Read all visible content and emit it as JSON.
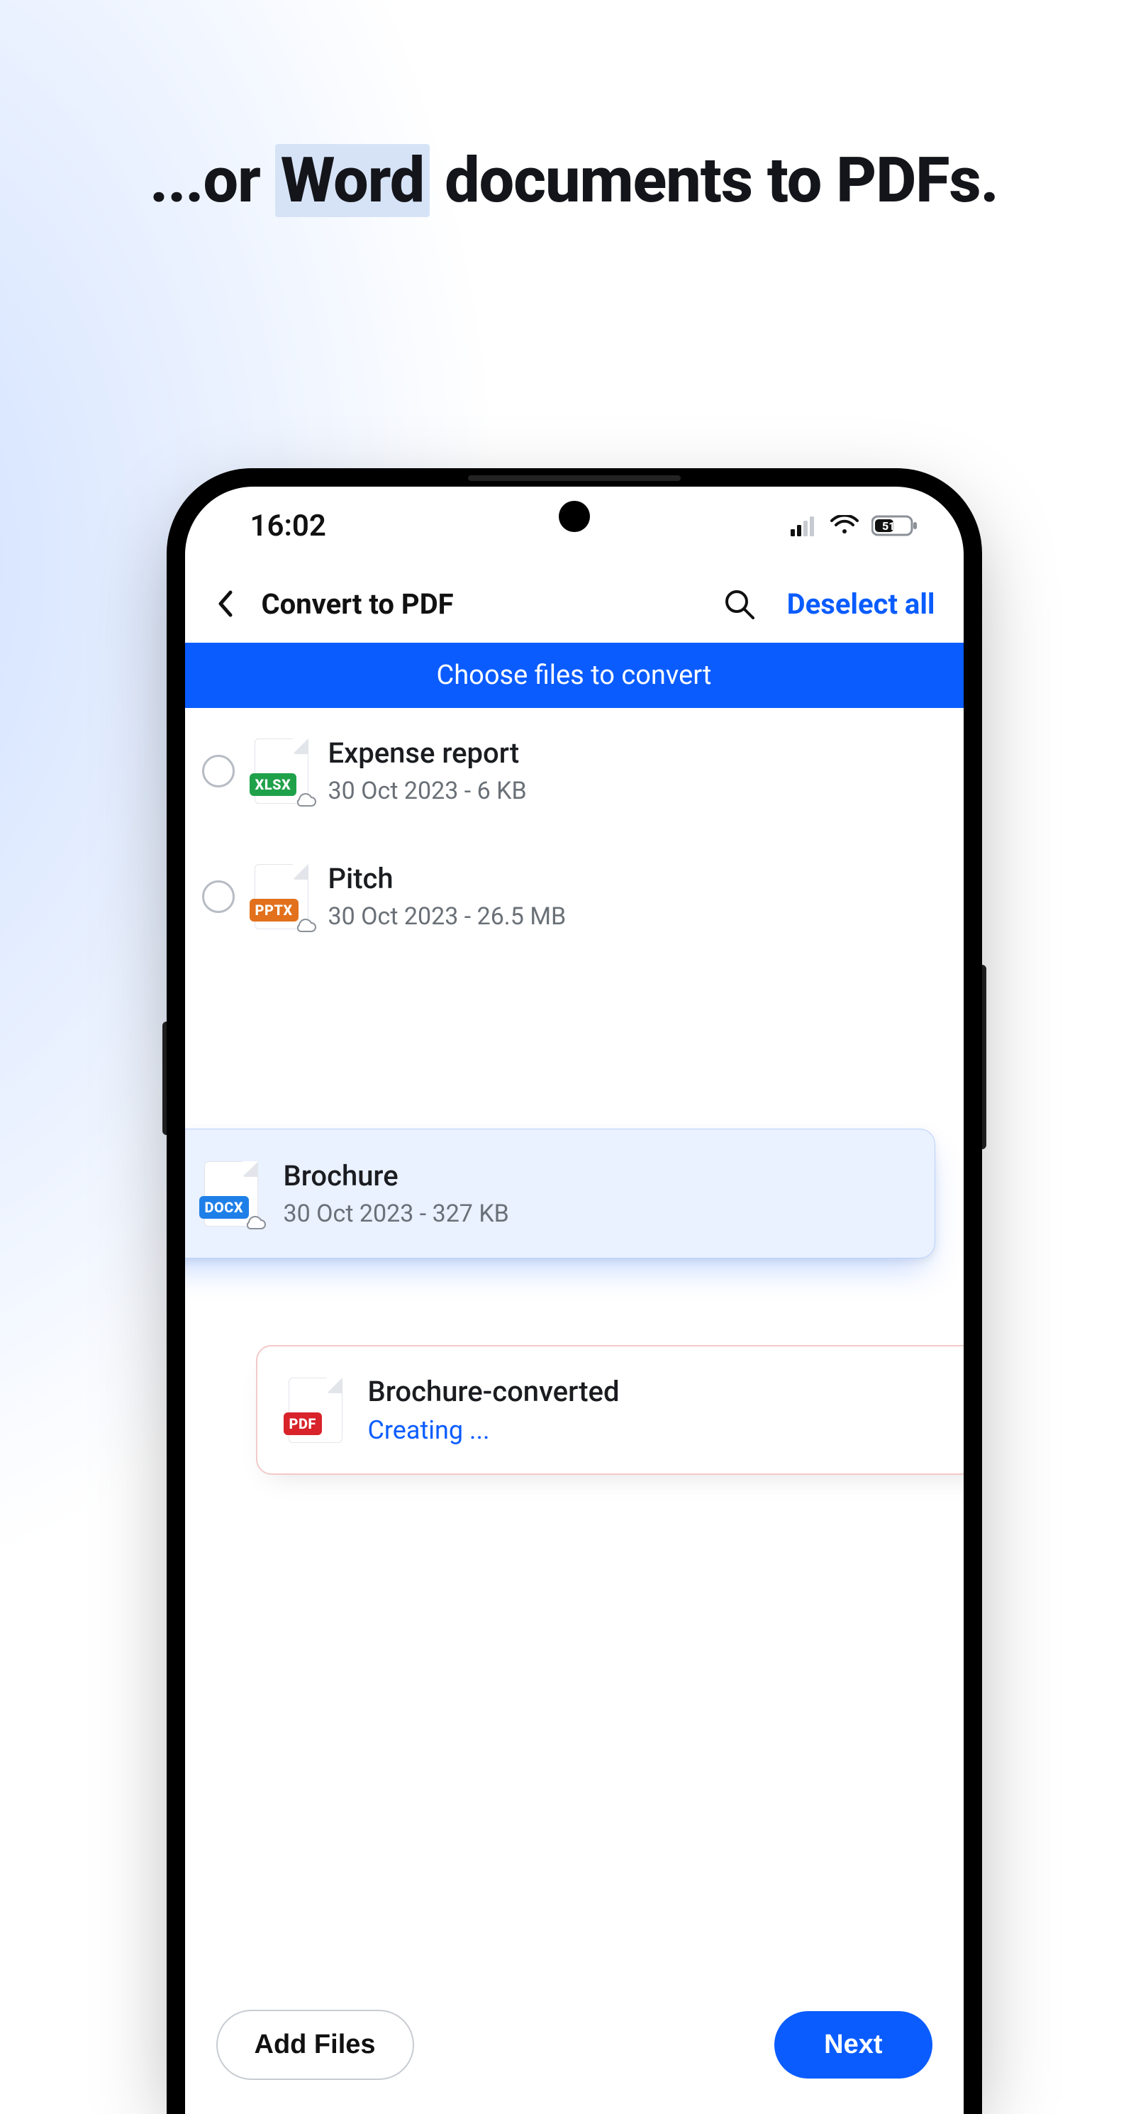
{
  "headline": {
    "pre": "...or ",
    "highlight": "Word",
    "post": " documents to PDFs."
  },
  "status": {
    "time": "16:02",
    "battery": "51"
  },
  "header": {
    "title": "Convert to PDF",
    "deselect": "Deselect all"
  },
  "banner": "Choose files to convert",
  "files": [
    {
      "name": "Expense report",
      "sub": "30 Oct 2023 - 6 KB",
      "badge": "XLSX",
      "badgeClass": "badge-xlsx",
      "selected": false
    },
    {
      "name": "Pitch",
      "sub": "30 Oct 2023 - 26.5 MB",
      "badge": "PPTX",
      "badgeClass": "badge-pptx",
      "selected": false
    },
    {
      "name": "Brochure",
      "sub": "30 Oct 2023 - 327 KB",
      "badge": "DOCX",
      "badgeClass": "badge-docx",
      "selected": true
    }
  ],
  "converted": {
    "name": "Brochure-converted",
    "status": "Creating ...",
    "badge": "PDF"
  },
  "buttons": {
    "add": "Add Files",
    "next": "Next"
  }
}
